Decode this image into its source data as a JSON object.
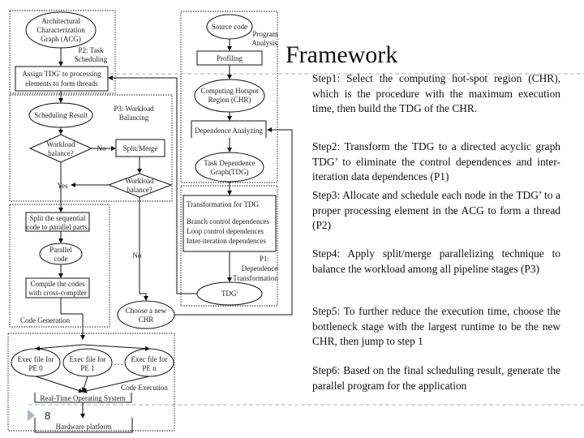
{
  "slide": {
    "title": "Framework",
    "page_number": "8",
    "steps": [
      "Step1: Select the computing hot-spot region (CHR), which is the procedure with the maximum execution time, then build the TDG of the CHR.",
      "Step2: Transform the TDG to a directed acyclic graph TDG’ to eliminate the control dependences and inter-iteration data dependences (P1)",
      "Step3: Allocate and schedule each node in the TDG’ to a proper processing element in the ACG to form a thread (P2)",
      "Step4: Apply split/merge parallelizing technique to balance the workload among all pipeline stages (P3)",
      "Step5: To further reduce the execution time, choose the bottleneck stage with the largest runtime to be the new CHR, then jump to step 1",
      "Step6: Based on the final scheduling result, generate the parallel program for the application"
    ]
  },
  "diagram": {
    "acg": [
      "Architectural",
      "Characterization",
      "Graph (ACG)"
    ],
    "task_scheduling": [
      "P2: Task",
      "Scheduling"
    ],
    "assign": [
      "Assign TDG' to processing",
      "elements to form threads"
    ],
    "scheduling_result": "Scheduling Result",
    "workload_balancing": [
      "P3: Workload",
      "Balancing"
    ],
    "workload_balance_q": [
      "Workload",
      "balance?"
    ],
    "no": "No",
    "yes": "Yes",
    "split_merge": "Split/Merge",
    "source_code": "Source code",
    "program_analysis": [
      "Program",
      "Analysis"
    ],
    "profiling": "Profiling",
    "chr": [
      "Computing Hotspot",
      "Region (CHR)"
    ],
    "dependence_analyzing": "Dependence Analyzing",
    "tdg_graph": [
      "Task Dependence",
      "Graph(TDG)"
    ],
    "transformation": [
      "Transformation for TDG",
      "Branch control dependences",
      "Loop control dependences",
      "Inter-iteration dependences"
    ],
    "dependence_transformation": [
      "P1:",
      "Dependence",
      "Transformation"
    ],
    "tdg": "TDG'",
    "choose_chr": [
      "Choose a new",
      "CHR"
    ],
    "split_code": [
      "Split the sequential",
      "code to parallel parts."
    ],
    "parallel_code": [
      "Parallel",
      "code"
    ],
    "compile": [
      "Compile the codes",
      "with cross-compiler"
    ],
    "code_generation": "Code Generation",
    "exec_files": [
      [
        "Exec file for",
        "PE 0"
      ],
      [
        "Exec file for",
        "PE 1"
      ],
      [
        "Exec file for",
        "PE n"
      ]
    ],
    "ellipsis": "…",
    "code_execution": "Code Execution",
    "rtos": "Real-Time Operating System",
    "hardware": "Hardware platform"
  },
  "colors": {
    "line": "#111111",
    "dashed_rule": "#a9b3bd",
    "page_marker": "#a7b8c8"
  }
}
